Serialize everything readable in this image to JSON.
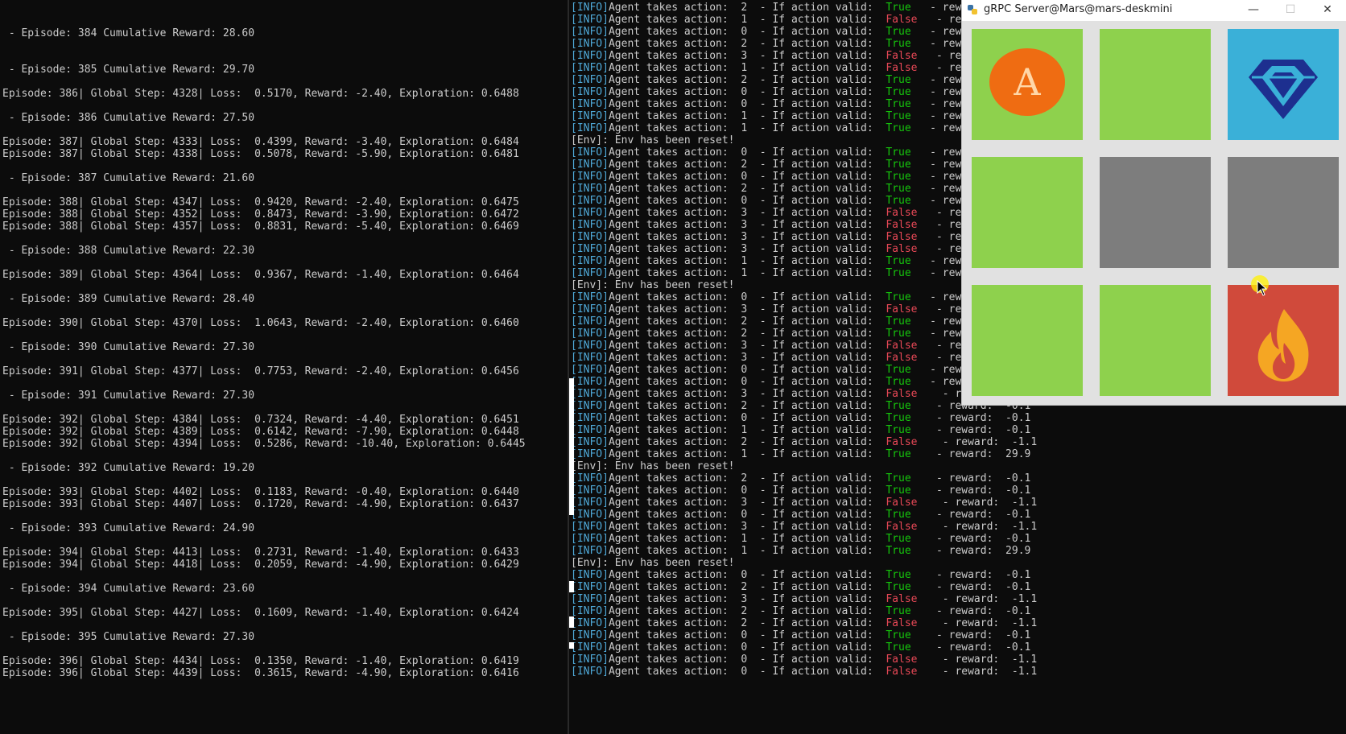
{
  "left_terminal": {
    "lines": [
      " - Episode: 384 Cumulative Reward: 28.60",
      " - Episode: 385 Cumulative Reward: 29.70",
      "Episode: 386| Global Step: 4328| Loss:  0.5170, Reward: -2.40, Exploration: 0.6488",
      " - Episode: 386 Cumulative Reward: 27.50",
      "Episode: 387| Global Step: 4333| Loss:  0.4399, Reward: -3.40, Exploration: 0.6484",
      "Episode: 387| Global Step: 4338| Loss:  0.5078, Reward: -5.90, Exploration: 0.6481",
      " - Episode: 387 Cumulative Reward: 21.60",
      "Episode: 388| Global Step: 4347| Loss:  0.9420, Reward: -2.40, Exploration: 0.6475",
      "Episode: 388| Global Step: 4352| Loss:  0.8473, Reward: -3.90, Exploration: 0.6472",
      "Episode: 388| Global Step: 4357| Loss:  0.8831, Reward: -5.40, Exploration: 0.6469",
      " - Episode: 388 Cumulative Reward: 22.30",
      "Episode: 389| Global Step: 4364| Loss:  0.9367, Reward: -1.40, Exploration: 0.6464",
      " - Episode: 389 Cumulative Reward: 28.40",
      "Episode: 390| Global Step: 4370| Loss:  1.0643, Reward: -2.40, Exploration: 0.6460",
      " - Episode: 390 Cumulative Reward: 27.30",
      "Episode: 391| Global Step: 4377| Loss:  0.7753, Reward: -2.40, Exploration: 0.6456",
      " - Episode: 391 Cumulative Reward: 27.30",
      "Episode: 392| Global Step: 4384| Loss:  0.7324, Reward: -4.40, Exploration: 0.6451",
      "Episode: 392| Global Step: 4389| Loss:  0.6142, Reward: -7.90, Exploration: 0.6448",
      "Episode: 392| Global Step: 4394| Loss:  0.5286, Reward: -10.40, Exploration: 0.6445",
      " - Episode: 392 Cumulative Reward: 19.20",
      "Episode: 393| Global Step: 4402| Loss:  0.1183, Reward: -0.40, Exploration: 0.6440",
      "Episode: 393| Global Step: 4407| Loss:  0.1720, Reward: -4.90, Exploration: 0.6437",
      " - Episode: 393 Cumulative Reward: 24.90",
      "Episode: 394| Global Step: 4413| Loss:  0.2731, Reward: -1.40, Exploration: 0.6433",
      "Episode: 394| Global Step: 4418| Loss:  0.2059, Reward: -4.90, Exploration: 0.6429",
      " - Episode: 394 Cumulative Reward: 23.60",
      "Episode: 395| Global Step: 4427| Loss:  0.1609, Reward: -1.40, Exploration: 0.6424",
      " - Episode: 395 Cumulative Reward: 27.30",
      "Episode: 396| Global Step: 4434| Loss:  0.1350, Reward: -1.40, Exploration: 0.6419",
      "Episode: 396| Global Step: 4439| Loss:  0.3615, Reward: -4.90, Exploration: 0.6416"
    ]
  },
  "right_terminal": {
    "lines": [
      {
        "kind": "action",
        "tag": "[INFO]",
        "text": "Agent takes action:  2  - If action valid:  ",
        "valid": "True",
        "tail": "- rew"
      },
      {
        "kind": "action",
        "tag": "[INFO]",
        "text": "Agent takes action:  1  - If action valid:  ",
        "valid": "False",
        "tail": "- re"
      },
      {
        "kind": "action",
        "tag": "[INFO]",
        "text": "Agent takes action:  0  - If action valid:  ",
        "valid": "True",
        "tail": "- rew"
      },
      {
        "kind": "action",
        "tag": "[INFO]",
        "text": "Agent takes action:  2  - If action valid:  ",
        "valid": "True",
        "tail": "- rew"
      },
      {
        "kind": "action",
        "tag": "[INFO]",
        "text": "Agent takes action:  3  - If action valid:  ",
        "valid": "False",
        "tail": "- re"
      },
      {
        "kind": "action",
        "tag": "[INFO]",
        "text": "Agent takes action:  1  - If action valid:  ",
        "valid": "False",
        "tail": "- re"
      },
      {
        "kind": "action",
        "tag": "[INFO]",
        "text": "Agent takes action:  2  - If action valid:  ",
        "valid": "True",
        "tail": "- rew"
      },
      {
        "kind": "action",
        "tag": "[INFO]",
        "text": "Agent takes action:  0  - If action valid:  ",
        "valid": "True",
        "tail": "- rew"
      },
      {
        "kind": "action",
        "tag": "[INFO]",
        "text": "Agent takes action:  0  - If action valid:  ",
        "valid": "True",
        "tail": "- rew"
      },
      {
        "kind": "action",
        "tag": "[INFO]",
        "text": "Agent takes action:  1  - If action valid:  ",
        "valid": "True",
        "tail": "- rew"
      },
      {
        "kind": "action",
        "tag": "[INFO]",
        "text": "Agent takes action:  1  - If action valid:  ",
        "valid": "True",
        "tail": "- rew"
      },
      {
        "kind": "env",
        "text": "[Env]: Env has been reset!"
      },
      {
        "kind": "action",
        "tag": "[INFO]",
        "text": "Agent takes action:  0  - If action valid:  ",
        "valid": "True",
        "tail": "- rew"
      },
      {
        "kind": "action",
        "tag": "[INFO]",
        "text": "Agent takes action:  2  - If action valid:  ",
        "valid": "True",
        "tail": "- rew"
      },
      {
        "kind": "action",
        "tag": "[INFO]",
        "text": "Agent takes action:  0  - If action valid:  ",
        "valid": "True",
        "tail": "- rew"
      },
      {
        "kind": "action",
        "tag": "[INFO]",
        "text": "Agent takes action:  2  - If action valid:  ",
        "valid": "True",
        "tail": "- rew"
      },
      {
        "kind": "action",
        "tag": "[INFO]",
        "text": "Agent takes action:  0  - If action valid:  ",
        "valid": "True",
        "tail": "- rew"
      },
      {
        "kind": "action",
        "tag": "[INFO]",
        "text": "Agent takes action:  3  - If action valid:  ",
        "valid": "False",
        "tail": "- re"
      },
      {
        "kind": "action",
        "tag": "[INFO]",
        "text": "Agent takes action:  3  - If action valid:  ",
        "valid": "False",
        "tail": "- re"
      },
      {
        "kind": "action",
        "tag": "[INFO]",
        "text": "Agent takes action:  3  - If action valid:  ",
        "valid": "False",
        "tail": "- re"
      },
      {
        "kind": "action",
        "tag": "[INFO]",
        "text": "Agent takes action:  3  - If action valid:  ",
        "valid": "False",
        "tail": "- re"
      },
      {
        "kind": "action",
        "tag": "[INFO]",
        "text": "Agent takes action:  1  - If action valid:  ",
        "valid": "True",
        "tail": "- rew"
      },
      {
        "kind": "action",
        "tag": "[INFO]",
        "text": "Agent takes action:  1  - If action valid:  ",
        "valid": "True",
        "tail": "- rew"
      },
      {
        "kind": "env",
        "text": "[Env]: Env has been reset!"
      },
      {
        "kind": "action",
        "tag": "[INFO]",
        "text": "Agent takes action:  0  - If action valid:  ",
        "valid": "True",
        "tail": "- rew"
      },
      {
        "kind": "action",
        "tag": "[INFO]",
        "text": "Agent takes action:  3  - If action valid:  ",
        "valid": "False",
        "tail": "- re"
      },
      {
        "kind": "action",
        "tag": "[INFO]",
        "text": "Agent takes action:  2  - If action valid:  ",
        "valid": "True",
        "tail": "- rew"
      },
      {
        "kind": "action",
        "tag": "[INFO]",
        "text": "Agent takes action:  2  - If action valid:  ",
        "valid": "True",
        "tail": "- rew"
      },
      {
        "kind": "action",
        "tag": "[INFO]",
        "text": "Agent takes action:  3  - If action valid:  ",
        "valid": "False",
        "tail": "- re"
      },
      {
        "kind": "action",
        "tag": "[INFO]",
        "text": "Agent takes action:  3  - If action valid:  ",
        "valid": "False",
        "tail": "- re"
      },
      {
        "kind": "action",
        "tag": "[INFO]",
        "text": "Agent takes action:  0  - If action valid:  ",
        "valid": "True",
        "tail": "- rew"
      },
      {
        "kind": "action",
        "tag": "[INFO]",
        "text": "Agent takes action:  0  - If action valid:  ",
        "valid": "True",
        "tail": "- reward:  -0.1"
      },
      {
        "kind": "action",
        "tag": "[INFO]",
        "text": "Agent takes action:  3  - If action valid:  ",
        "valid": "False",
        "tail": " - reward:  -1.1"
      },
      {
        "kind": "action",
        "tag": "[INFO]",
        "text": "Agent takes action:  2  - If action valid:  ",
        "valid": "True",
        "tail": " - reward:  -0.1"
      },
      {
        "kind": "action",
        "tag": "[INFO]",
        "text": "Agent takes action:  0  - If action valid:  ",
        "valid": "True",
        "tail": " - reward:  -0.1"
      },
      {
        "kind": "action",
        "tag": "[INFO]",
        "text": "Agent takes action:  1  - If action valid:  ",
        "valid": "True",
        "tail": " - reward:  -0.1"
      },
      {
        "kind": "action",
        "tag": "[INFO]",
        "text": "Agent takes action:  2  - If action valid:  ",
        "valid": "False",
        "tail": " - reward:  -1.1"
      },
      {
        "kind": "action",
        "tag": "[INFO]",
        "text": "Agent takes action:  1  - If action valid:  ",
        "valid": "True",
        "tail": " - reward:  29.9"
      },
      {
        "kind": "env",
        "text": "[Env]: Env has been reset!"
      },
      {
        "kind": "action",
        "tag": "[INFO]",
        "text": "Agent takes action:  2  - If action valid:  ",
        "valid": "True",
        "tail": " - reward:  -0.1"
      },
      {
        "kind": "action",
        "tag": "[INFO]",
        "text": "Agent takes action:  0  - If action valid:  ",
        "valid": "True",
        "tail": " - reward:  -0.1"
      },
      {
        "kind": "action",
        "tag": "[INFO]",
        "text": "Agent takes action:  3  - If action valid:  ",
        "valid": "False",
        "tail": " - reward:  -1.1"
      },
      {
        "kind": "action",
        "tag": "[INFO]",
        "text": "Agent takes action:  0  - If action valid:  ",
        "valid": "True",
        "tail": " - reward:  -0.1"
      },
      {
        "kind": "action",
        "tag": "[INFO]",
        "text": "Agent takes action:  3  - If action valid:  ",
        "valid": "False",
        "tail": " - reward:  -1.1"
      },
      {
        "kind": "action",
        "tag": "[INFO]",
        "text": "Agent takes action:  1  - If action valid:  ",
        "valid": "True",
        "tail": " - reward:  -0.1"
      },
      {
        "kind": "action",
        "tag": "[INFO]",
        "text": "Agent takes action:  1  - If action valid:  ",
        "valid": "True",
        "tail": " - reward:  29.9"
      },
      {
        "kind": "env",
        "text": "[Env]: Env has been reset!"
      },
      {
        "kind": "action",
        "tag": "[INFO]",
        "text": "Agent takes action:  0  - If action valid:  ",
        "valid": "True",
        "tail": " - reward:  -0.1"
      },
      {
        "kind": "action",
        "tag": "[INFO]",
        "text": "Agent takes action:  2  - If action valid:  ",
        "valid": "True",
        "tail": " - reward:  -0.1"
      },
      {
        "kind": "action",
        "tag": "[INFO]",
        "text": "Agent takes action:  3  - If action valid:  ",
        "valid": "False",
        "tail": " - reward:  -1.1"
      },
      {
        "kind": "action",
        "tag": "[INFO]",
        "text": "Agent takes action:  2  - If action valid:  ",
        "valid": "True",
        "tail": " - reward:  -0.1"
      },
      {
        "kind": "action",
        "tag": "[INFO]",
        "text": "Agent takes action:  2  - If action valid:  ",
        "valid": "False",
        "tail": " - reward:  -1.1"
      },
      {
        "kind": "action",
        "tag": "[INFO]",
        "text": "Agent takes action:  0  - If action valid:  ",
        "valid": "True",
        "tail": " - reward:  -0.1"
      },
      {
        "kind": "action",
        "tag": "[INFO]",
        "text": "Agent takes action:  0  - If action valid:  ",
        "valid": "True",
        "tail": " - reward:  -0.1"
      },
      {
        "kind": "action",
        "tag": "[INFO]",
        "text": "Agent takes action:  0  - If action valid:  ",
        "valid": "False",
        "tail": " - reward:  -1.1"
      },
      {
        "kind": "action",
        "tag": "[INFO]",
        "text": "Agent takes action:  0  - If action valid:  ",
        "valid": "False",
        "tail": " - reward:  -1.1"
      }
    ]
  },
  "game_window": {
    "title": "gRPC Server@Mars@mars-deskmini",
    "minimize_label": "—",
    "maximize_label": "☐",
    "close_label": "✕",
    "agent_label": "A",
    "cells": [
      "agent",
      "empty",
      "goal",
      "empty",
      "wall",
      "wall",
      "empty",
      "empty",
      "fire"
    ],
    "colors": {
      "empty": "#8ed14d",
      "goal": "#3ab0d8",
      "wall": "#7d7d7d",
      "fire": "#d04a3b",
      "agent": "#ef6c12",
      "gem": "#1d2f8f",
      "flame": "#f5a623"
    },
    "icons": {
      "agent": "agent-badge-icon",
      "goal": "diamond-icon",
      "fire": "fire-icon"
    }
  }
}
